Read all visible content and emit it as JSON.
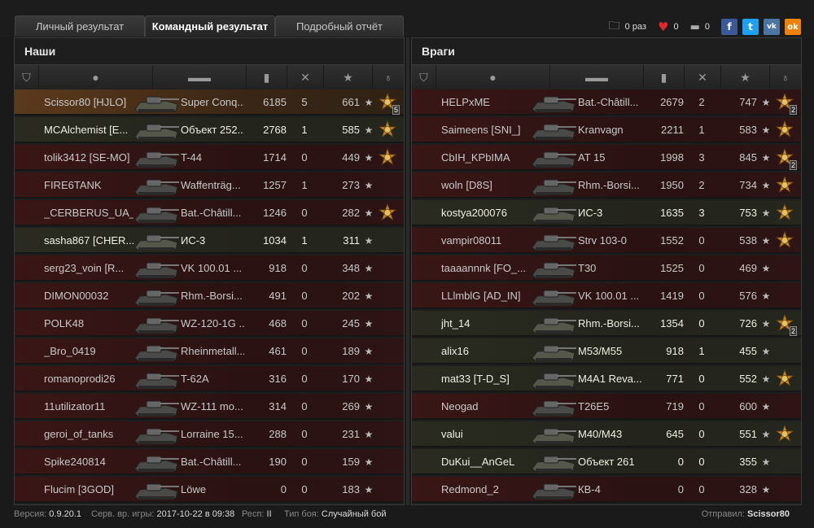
{
  "tabs": [
    "Личный результат",
    "Командный результат",
    "Подробный отчёт"
  ],
  "toolbar": {
    "saves_count": "0 раз",
    "likes_count": "0",
    "comments_count": "0",
    "share": [
      "f",
      "t",
      "vk",
      "ok"
    ]
  },
  "allies": {
    "title": "Наши",
    "rows": [
      {
        "name": "Scissor80 [HJLO]",
        "tank": "Super Conq...",
        "damage": "6185",
        "kills": "5",
        "xp": "661",
        "medal": true,
        "medal_count": "5",
        "state": "me"
      },
      {
        "name": "MCAlchemist [E...",
        "tank": "Объект 252...",
        "damage": "2768",
        "kills": "1",
        "xp": "585",
        "medal": true,
        "medal_count": "",
        "state": "alive"
      },
      {
        "name": "tolik3412 [SE-MO]",
        "tank": "T-44",
        "damage": "1714",
        "kills": "0",
        "xp": "449",
        "medal": true,
        "medal_count": "",
        "state": "dead"
      },
      {
        "name": "FIRE6TANK",
        "tank": "Waffenträg...",
        "damage": "1257",
        "kills": "1",
        "xp": "273",
        "medal": false,
        "medal_count": "",
        "state": "dead"
      },
      {
        "name": "_CERBERUS_UA_",
        "tank": "Bat.-Châtill...",
        "damage": "1246",
        "kills": "0",
        "xp": "282",
        "medal": true,
        "medal_count": "",
        "state": "dead"
      },
      {
        "name": "sasha867 [CHER...",
        "tank": "ИС-3",
        "damage": "1034",
        "kills": "1",
        "xp": "311",
        "medal": false,
        "medal_count": "",
        "state": "alive"
      },
      {
        "name": "serg23_voin [R...",
        "tank": "VK 100.01 ...",
        "damage": "918",
        "kills": "0",
        "xp": "348",
        "medal": false,
        "medal_count": "",
        "state": "dead"
      },
      {
        "name": "DIMON00032",
        "tank": "Rhm.-Borsi...",
        "damage": "491",
        "kills": "0",
        "xp": "202",
        "medal": false,
        "medal_count": "",
        "state": "dead"
      },
      {
        "name": "POLK48",
        "tank": "WZ-120-1G ...",
        "damage": "468",
        "kills": "0",
        "xp": "245",
        "medal": false,
        "medal_count": "",
        "state": "dead"
      },
      {
        "name": "_Bro_0419",
        "tank": "Rheinmetall...",
        "damage": "461",
        "kills": "0",
        "xp": "189",
        "medal": false,
        "medal_count": "",
        "state": "dead"
      },
      {
        "name": "romanoprodi26",
        "tank": "T-62A",
        "damage": "316",
        "kills": "0",
        "xp": "170",
        "medal": false,
        "medal_count": "",
        "state": "dead"
      },
      {
        "name": "11utilizator11",
        "tank": "WZ-111 mo...",
        "damage": "314",
        "kills": "0",
        "xp": "269",
        "medal": false,
        "medal_count": "",
        "state": "dead"
      },
      {
        "name": "geroi_of_tanks",
        "tank": "Lorraine 15...",
        "damage": "288",
        "kills": "0",
        "xp": "231",
        "medal": false,
        "medal_count": "",
        "state": "dead"
      },
      {
        "name": "Spike240814",
        "tank": "Bat.-Châtill...",
        "damage": "190",
        "kills": "0",
        "xp": "159",
        "medal": false,
        "medal_count": "",
        "state": "dead"
      },
      {
        "name": "Flucim [3GOD]",
        "tank": "Löwe",
        "damage": "0",
        "kills": "0",
        "xp": "183",
        "medal": false,
        "medal_count": "",
        "state": "dead"
      }
    ]
  },
  "enemies": {
    "title": "Враги",
    "rows": [
      {
        "name": "HELPxME",
        "tank": "Bat.-Châtill...",
        "damage": "2679",
        "kills": "2",
        "xp": "747",
        "medal": true,
        "medal_count": "2",
        "state": "dead"
      },
      {
        "name": "Saimeens [SNI_]",
        "tank": "Kranvagn",
        "damage": "2211",
        "kills": "1",
        "xp": "583",
        "medal": true,
        "medal_count": "",
        "state": "dead"
      },
      {
        "name": "CbIH_KPbIMA",
        "tank": "AT 15",
        "damage": "1998",
        "kills": "3",
        "xp": "845",
        "medal": true,
        "medal_count": "2",
        "state": "dead"
      },
      {
        "name": "woln [D8S]",
        "tank": "Rhm.-Borsi...",
        "damage": "1950",
        "kills": "2",
        "xp": "734",
        "medal": true,
        "medal_count": "",
        "state": "dead"
      },
      {
        "name": "kostya200076",
        "tank": "ИС-3",
        "damage": "1635",
        "kills": "3",
        "xp": "753",
        "medal": true,
        "medal_count": "",
        "state": "alive"
      },
      {
        "name": "vampir08011",
        "tank": "Strv 103-0",
        "damage": "1552",
        "kills": "0",
        "xp": "538",
        "medal": true,
        "medal_count": "",
        "state": "dead"
      },
      {
        "name": "taaaannnk [FO_...",
        "tank": "T30",
        "damage": "1525",
        "kills": "0",
        "xp": "469",
        "medal": false,
        "medal_count": "",
        "state": "dead"
      },
      {
        "name": "LLlmblG [AD_IN]",
        "tank": "VK 100.01 ...",
        "damage": "1419",
        "kills": "0",
        "xp": "576",
        "medal": false,
        "medal_count": "",
        "state": "dead"
      },
      {
        "name": "jht_14",
        "tank": "Rhm.-Borsi...",
        "damage": "1354",
        "kills": "0",
        "xp": "726",
        "medal": true,
        "medal_count": "2",
        "state": "alive"
      },
      {
        "name": "alix16",
        "tank": "M53/M55",
        "damage": "918",
        "kills": "1",
        "xp": "455",
        "medal": false,
        "medal_count": "",
        "state": "alive"
      },
      {
        "name": "mat33 [T-D_S]",
        "tank": "M4A1 Reva...",
        "damage": "771",
        "kills": "0",
        "xp": "552",
        "medal": true,
        "medal_count": "",
        "state": "alive"
      },
      {
        "name": "Neogad",
        "tank": "T26E5",
        "damage": "719",
        "kills": "0",
        "xp": "600",
        "medal": false,
        "medal_count": "",
        "state": "dead"
      },
      {
        "name": "valui",
        "tank": "M40/M43",
        "damage": "645",
        "kills": "0",
        "xp": "551",
        "medal": true,
        "medal_count": "",
        "state": "alive"
      },
      {
        "name": "DuKui__AnGeL",
        "tank": "Объект 261",
        "damage": "0",
        "kills": "0",
        "xp": "355",
        "medal": false,
        "medal_count": "",
        "state": "alive"
      },
      {
        "name": "Redmond_2",
        "tank": "КВ-4",
        "damage": "0",
        "kills": "0",
        "xp": "328",
        "medal": false,
        "medal_count": "",
        "state": "dead"
      }
    ]
  },
  "footer": {
    "version_label": "Версия:",
    "version": "0.9.20.1",
    "server_time_label": "Серв. вр. игры:",
    "server_time": "2017-10-22 в 09:38",
    "res_label": "Респ:",
    "res": "II",
    "battle_type_label": "Тип боя:",
    "battle_type": "Случайный бой",
    "sent_label": "Отправил:",
    "sent_by": "Scissor80"
  },
  "colors": {
    "row_dead": "#2a1212",
    "row_alive": "#23241c",
    "row_me": "#5b3a1c",
    "medal": "#c58a2a"
  }
}
